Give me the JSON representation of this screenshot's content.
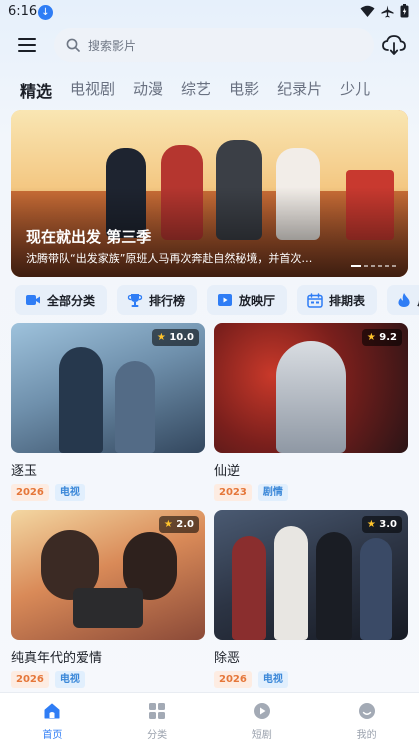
{
  "status": {
    "time": "6:16"
  },
  "search": {
    "placeholder": "搜索影片"
  },
  "tabs": [
    {
      "label": "精选"
    },
    {
      "label": "电视剧"
    },
    {
      "label": "动漫"
    },
    {
      "label": "综艺"
    },
    {
      "label": "电影"
    },
    {
      "label": "纪录片"
    },
    {
      "label": "少儿"
    }
  ],
  "banner": {
    "title": "现在就出发 第三季",
    "subtitle": "沈腾带队“出发家族”原班人马再次奔赴自然秘境，并首次…",
    "slides": 6,
    "current": 1
  },
  "shortcuts": [
    {
      "label": "全部分类",
      "icon": "video-camera-icon"
    },
    {
      "label": "排行榜",
      "icon": "trophy-icon"
    },
    {
      "label": "放映厅",
      "icon": "play-screen-icon"
    },
    {
      "label": "排期表",
      "icon": "calendar-icon"
    },
    {
      "label": "片单",
      "icon": "flame-icon"
    }
  ],
  "cards": [
    {
      "title": "逐玉",
      "rating": "10.0",
      "year": "2026",
      "type": "电视"
    },
    {
      "title": "仙逆",
      "rating": "9.2",
      "year": "2023",
      "type": "剧情"
    },
    {
      "title": "纯真年代的爱情",
      "rating": "2.0",
      "year": "2026",
      "type": "电视"
    },
    {
      "title": "除恶",
      "rating": "3.0",
      "year": "2026",
      "type": "电视"
    }
  ],
  "nav": [
    {
      "label": "首页",
      "icon": "home-icon"
    },
    {
      "label": "分类",
      "icon": "grid-icon"
    },
    {
      "label": "短剧",
      "icon": "play-circle-icon"
    },
    {
      "label": "我的",
      "icon": "profile-icon"
    }
  ],
  "colors": {
    "accent": "#2f7df5",
    "year_badge": "#e5773a",
    "type_badge": "#3a87d8"
  }
}
